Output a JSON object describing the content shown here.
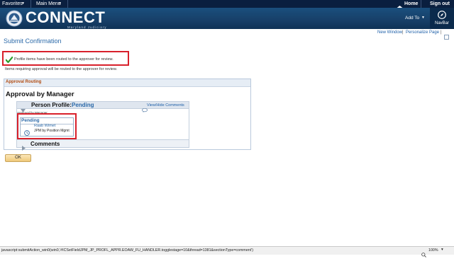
{
  "menubar": {
    "favorites": "Favorites",
    "main_menu": "Main Menu",
    "home": "Home",
    "sign_out": "Sign out"
  },
  "header": {
    "logo_text": "CONNECT",
    "logo_subtitle": "Maryland Judiciary",
    "add_to": "Add To",
    "navbar": "NavBar"
  },
  "links": {
    "new_window": "New Window",
    "separator": "|",
    "personalize_page": "Personalize Page"
  },
  "page": {
    "title": "Submit Confirmation",
    "confirmation_message": "Profile items have been routed to the approver for review.",
    "sub_message": "Items requiring approval will be routed to the approver for review."
  },
  "routing": {
    "section_title": "Approval Routing",
    "heading": "Approval by Manager",
    "item_label": "Person Profile:",
    "item_status": "Pending",
    "view_hide_comments": "View/Hide Comments",
    "approval_by_label": "Approval by Manager",
    "pending_title": "Pending",
    "approver_name": "Raab Wimet",
    "approver_role": "JPM by Position Mgmt",
    "comments_label": "Comments"
  },
  "ok_button": "OK",
  "statusbar": {
    "url": "javascript:submitAction_win0(win0,'#ICSetFieldJPM_JP_PROFL_APPR.EOAW_FU_HANDLER.togglestage=10&thread=1381&sectionType=comment')",
    "zoom": "100%"
  },
  "icons": {
    "check": "checkmark-icon",
    "home": "home-icon",
    "navbar": "compass-icon",
    "clock": "clock-icon",
    "comment": "speech-bubble-icon"
  },
  "colors": {
    "menubar": "#0a1f3f",
    "header": "#173f68",
    "link": "#1d5fa8",
    "highlight_border": "#d8202b",
    "check_green": "#2e9e2e",
    "section_title": "#b04a10"
  }
}
